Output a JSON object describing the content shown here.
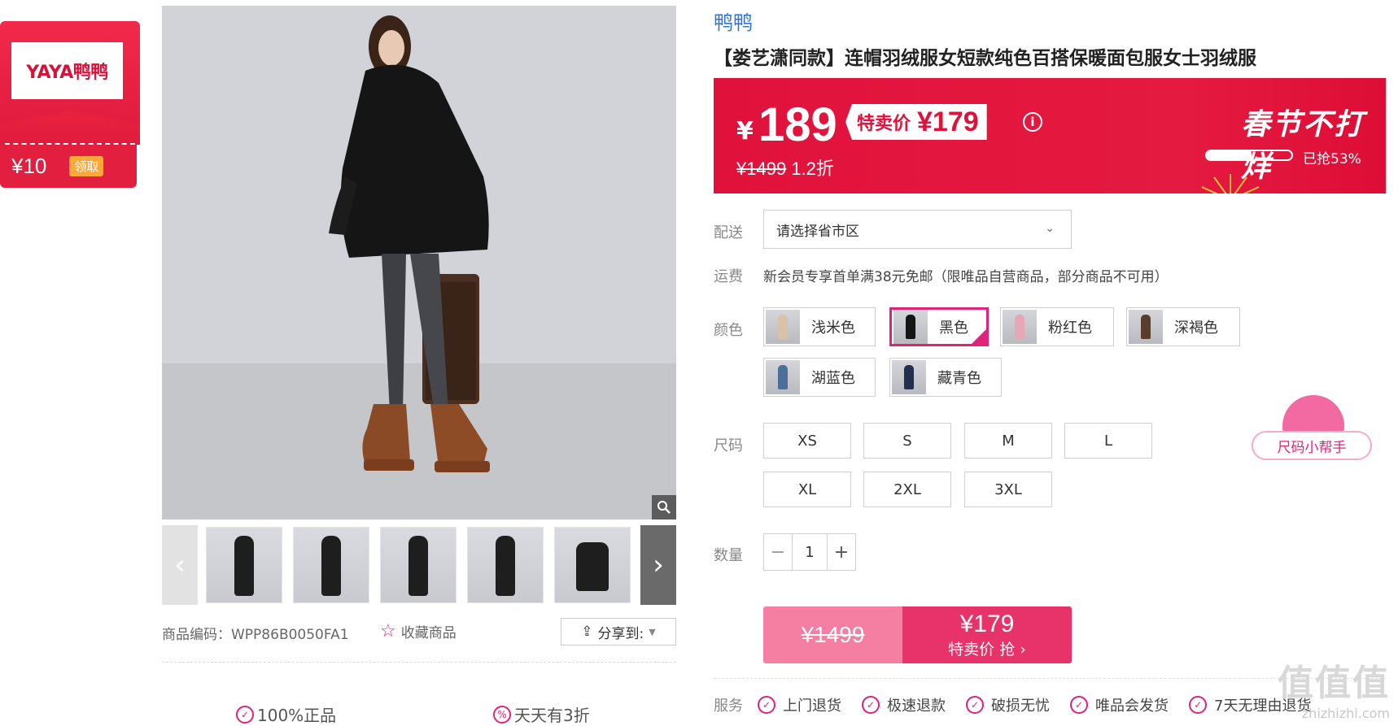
{
  "coupon": {
    "logo": "YAYA鸭鸭",
    "amount": "¥10",
    "claim": "领取"
  },
  "gallery": {
    "sku_code": "商品编码：WPP86B0050FA1",
    "favorite": "收藏商品",
    "share": "分享到:"
  },
  "guarantees": [
    "100%正品",
    "天天有3折"
  ],
  "product": {
    "brand": "鸭鸭",
    "title": "【娄艺潇同款】连帽羽绒服女短款纯色百搭保暖面包服女士羽绒服"
  },
  "price": {
    "currency": "¥",
    "main": "189",
    "special_label": "特卖价",
    "special_price": "¥179",
    "original": "¥1499",
    "discount": "1.2折",
    "promo": "春节不打烊",
    "progress": 0.53,
    "progress_label": "已抢53%"
  },
  "delivery": {
    "label": "配送",
    "placeholder": "请选择省市区"
  },
  "shipping": {
    "label": "运费",
    "text": "新会员专享首单满38元免邮（限唯品自营商品，部分商品不可用）"
  },
  "colors": {
    "label": "颜色",
    "options": [
      "浅米色",
      "黑色",
      "粉红色",
      "深褐色",
      "湖蓝色",
      "藏青色"
    ],
    "selected": "黑色"
  },
  "sizes": {
    "label": "尺码",
    "options": [
      "XS",
      "S",
      "M",
      "L",
      "XL",
      "2XL",
      "3XL"
    ],
    "helper": "尺码小帮手"
  },
  "quantity": {
    "label": "数量",
    "value": "1",
    "minus": "−",
    "plus": "+"
  },
  "buy": {
    "original": "¥1499",
    "price": "¥179",
    "cta": "特卖价 抢 ›"
  },
  "services": {
    "label": "服务",
    "items": [
      "上门退货",
      "极速退款",
      "破损无忧",
      "唯品会发货",
      "7天无理由退货"
    ]
  },
  "watermark": {
    "big": "值值值",
    "small": "zhizhizhi.com"
  },
  "colors_theme": {
    "accent": "#e0227a",
    "price_red": "#e0123c",
    "brand_blue": "#2f73d8"
  }
}
